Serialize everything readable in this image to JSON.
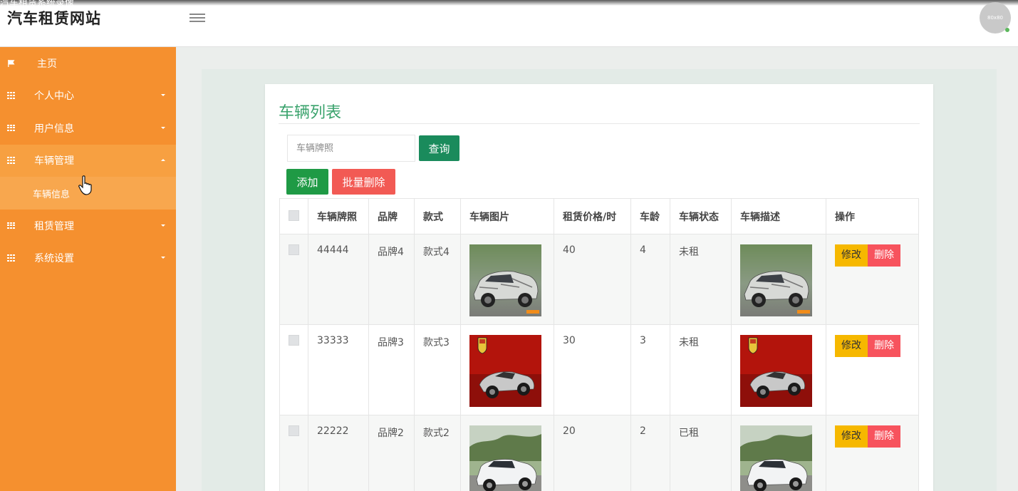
{
  "overlay_text": "汽车租赁系统录像",
  "header": {
    "site_title": "汽车租赁网站",
    "avatar_text": "80x80"
  },
  "sidebar": {
    "items": [
      {
        "label": "主页",
        "icon": "flag-icon",
        "expandable": false
      },
      {
        "label": "个人中心",
        "icon": "grid-icon",
        "expandable": true
      },
      {
        "label": "用户信息",
        "icon": "grid-icon",
        "expandable": true
      },
      {
        "label": "车辆管理",
        "icon": "grid-icon",
        "expandable": true,
        "expanded": true
      },
      {
        "label": "租赁管理",
        "icon": "grid-icon",
        "expandable": true
      },
      {
        "label": "系统设置",
        "icon": "grid-icon",
        "expandable": true
      }
    ],
    "sub_item": "车辆信息"
  },
  "main": {
    "title": "车辆列表",
    "search_placeholder": "车辆牌照",
    "query_button": "查询",
    "add_button": "添加",
    "batch_delete_button": "批量删除",
    "edit_label": "修改",
    "delete_label": "删除",
    "columns": [
      "车辆牌照",
      "品牌",
      "款式",
      "车辆图片",
      "租赁价格/时",
      "车龄",
      "车辆状态",
      "车辆描述",
      "操作"
    ],
    "rows": [
      {
        "plate": "44444",
        "brand": "品牌4",
        "style": "款式4",
        "image": "camo-suv",
        "price": "40",
        "age": "4",
        "status": "未租",
        "desc_image": "camo-suv"
      },
      {
        "plate": "33333",
        "brand": "品牌3",
        "style": "款式3",
        "image": "silver-sports-car",
        "price": "30",
        "age": "3",
        "status": "未租",
        "desc_image": "silver-sports-car"
      },
      {
        "plate": "22222",
        "brand": "品牌2",
        "style": "款式2",
        "image": "white-suv",
        "price": "20",
        "age": "2",
        "status": "已租",
        "desc_image": "white-suv"
      }
    ]
  },
  "colors": {
    "sidebar": "#f5902f",
    "title_green": "#3ba36d",
    "query": "#1a8b5c",
    "add": "#1f9a45",
    "batch_delete": "#f25a54",
    "edit": "#f6b800",
    "delete": "#f7535d"
  }
}
